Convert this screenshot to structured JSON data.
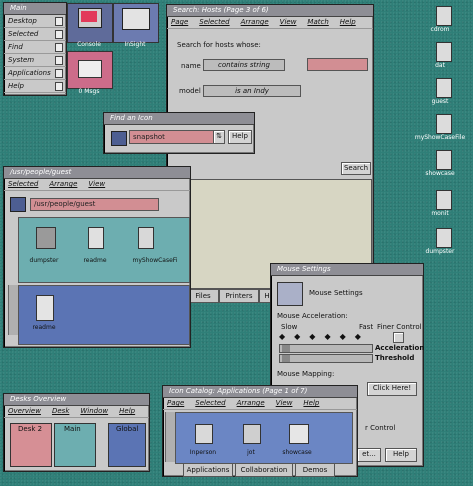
{
  "toolchest": {
    "title": "Main",
    "items": [
      "Desktop",
      "Selected",
      "Find",
      "System",
      "Applications",
      "Help"
    ]
  },
  "top_icons": [
    {
      "label": "Console"
    },
    {
      "label": "InSight"
    },
    {
      "label": "0 Msgs"
    }
  ],
  "search": {
    "title": "Search: Hosts (Page 3 of 6)",
    "menu": [
      "Page",
      "Selected",
      "Arrange",
      "View",
      "Match",
      "Help"
    ],
    "heading": "Search for hosts whose:",
    "name_label": "name",
    "name_option": "contains string",
    "model_label": "model",
    "model_option": "is an Indy",
    "search_button": "Search",
    "tabs": [
      "Files",
      "Printers",
      "H"
    ]
  },
  "find_icon": {
    "title": "Find an Icon",
    "value": "snapshot",
    "help": "Help"
  },
  "guest": {
    "title": "/usr/people/guest",
    "menu": [
      "Selected",
      "Arrange",
      "View"
    ],
    "path": "/usr/people/guest",
    "icons": [
      "dumpster",
      "readme",
      "myShowCaseFi"
    ],
    "lower_icon": "readme"
  },
  "right_icons": [
    "cdrom",
    "dat",
    "guest",
    "myShowCaseFile",
    "showcase",
    "monit",
    "dumpster"
  ],
  "mouse": {
    "title": "Mouse Settings",
    "heading": "Mouse Settings",
    "accel_label": "Mouse Acceleration:",
    "slow": "Slow",
    "fast": "Fast",
    "finer": "Finer Control",
    "acceleration": "Acceleration",
    "threshold": "Threshold",
    "mapping": "Mouse Mapping:",
    "click_here": "Click Here!",
    "rcontrol": "r Control",
    "help": "Help",
    "set": "et..."
  },
  "desks": {
    "title": "Desks Overview",
    "menu": [
      "Overview",
      "Desk",
      "Window",
      "Help"
    ],
    "items": [
      "Desk 2",
      "Main",
      "Global"
    ]
  },
  "catalog": {
    "title": "Icon Catalog: Applications (Page 1 of 7)",
    "menu": [
      "Page",
      "Selected",
      "Arrange",
      "View",
      "Help"
    ],
    "icons": [
      "Inperson",
      "jot",
      "showcase"
    ],
    "tabs": [
      "Applications",
      "Collaboration",
      "Demos"
    ]
  }
}
